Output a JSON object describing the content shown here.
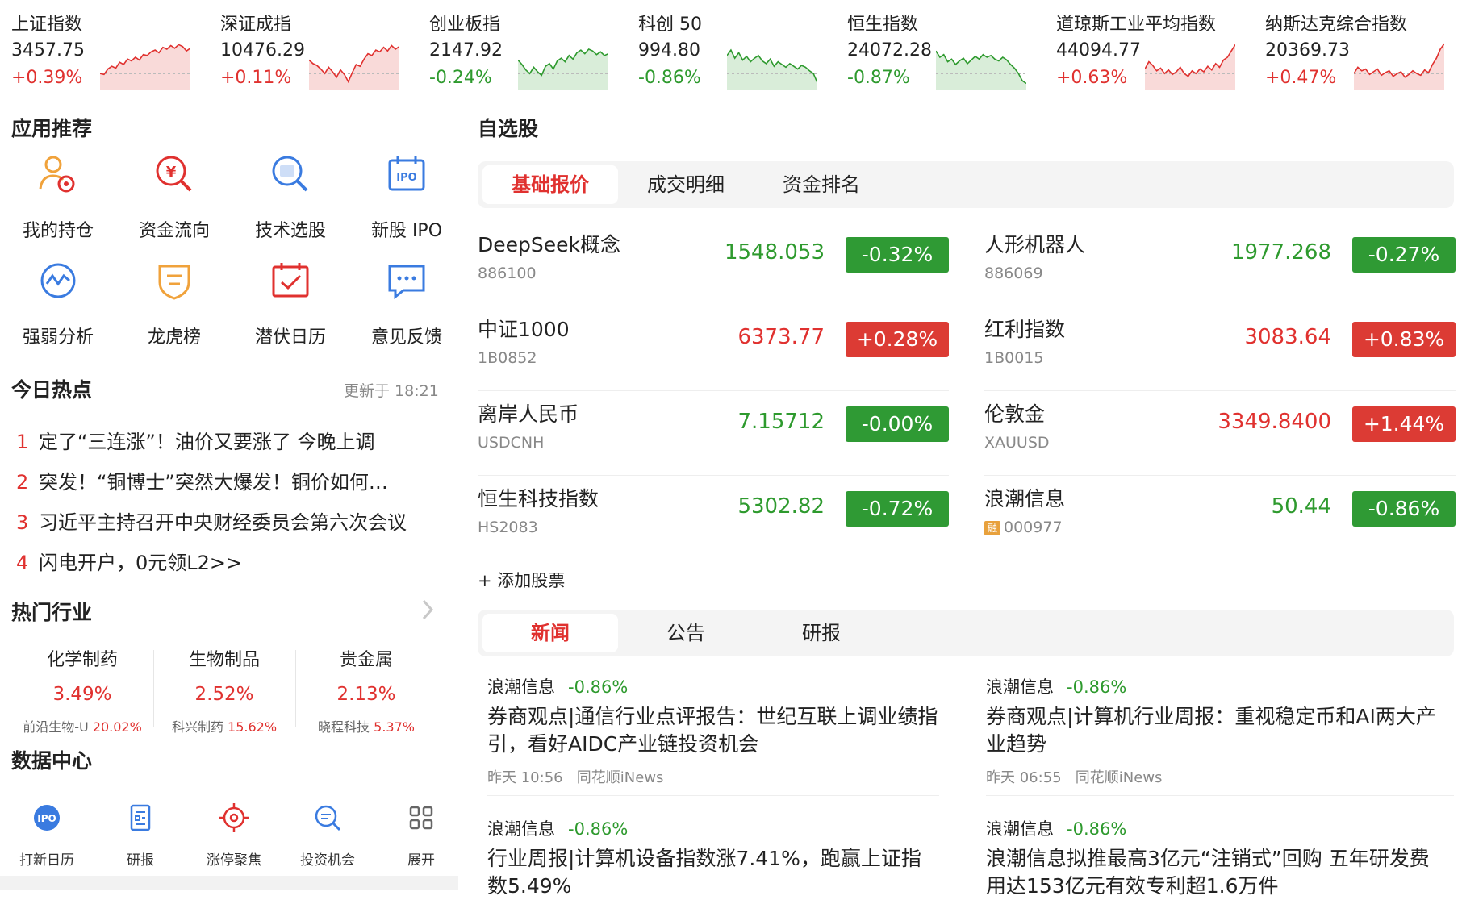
{
  "indices": [
    {
      "name": "上证指数",
      "value": "3457.75",
      "change": "+0.39%",
      "dir": "up",
      "spark": [
        0.3,
        0.28,
        0.4,
        0.46,
        0.42,
        0.55,
        0.5,
        0.62,
        0.58,
        0.66,
        0.6,
        0.72,
        0.7,
        0.78,
        0.82,
        0.76,
        0.88,
        0.84,
        0.92,
        0.86,
        0.94,
        0.9,
        0.8,
        0.86
      ]
    },
    {
      "name": "深证成指",
      "value": "10476.29",
      "change": "+0.11%",
      "dir": "up",
      "spark": [
        0.6,
        0.52,
        0.48,
        0.4,
        0.3,
        0.44,
        0.34,
        0.22,
        0.38,
        0.28,
        0.12,
        0.32,
        0.5,
        0.46,
        0.62,
        0.74,
        0.7,
        0.82,
        0.78,
        0.88,
        0.8,
        0.92,
        0.84,
        0.9
      ]
    },
    {
      "name": "创业板指",
      "value": "2147.92",
      "change": "-0.24%",
      "dir": "down",
      "spark": [
        0.6,
        0.5,
        0.38,
        0.3,
        0.44,
        0.34,
        0.26,
        0.46,
        0.52,
        0.4,
        0.58,
        0.64,
        0.56,
        0.7,
        0.62,
        0.76,
        0.82,
        0.74,
        0.84,
        0.8,
        0.72,
        0.78,
        0.7,
        0.74
      ]
    },
    {
      "name": "科创 50",
      "value": "994.80",
      "change": "-0.86%",
      "dir": "down",
      "spark": [
        0.7,
        0.82,
        0.64,
        0.76,
        0.6,
        0.68,
        0.56,
        0.64,
        0.7,
        0.58,
        0.52,
        0.62,
        0.46,
        0.56,
        0.5,
        0.44,
        0.52,
        0.46,
        0.4,
        0.48,
        0.44,
        0.36,
        0.3,
        0.1
      ]
    },
    {
      "name": "恒生指数",
      "value": "24072.28",
      "change": "-0.87%",
      "dir": "down",
      "spark": [
        0.8,
        0.66,
        0.72,
        0.56,
        0.62,
        0.5,
        0.58,
        0.64,
        0.52,
        0.6,
        0.68,
        0.62,
        0.72,
        0.66,
        0.7,
        0.62,
        0.58,
        0.66,
        0.6,
        0.5,
        0.42,
        0.3,
        0.14,
        0.08
      ]
    },
    {
      "name": "道琼斯工业平均指数",
      "value": "44094.77",
      "change": "+0.63%",
      "dir": "up",
      "spark": [
        0.4,
        0.56,
        0.48,
        0.36,
        0.42,
        0.3,
        0.38,
        0.28,
        0.34,
        0.44,
        0.3,
        0.24,
        0.36,
        0.3,
        0.4,
        0.34,
        0.46,
        0.38,
        0.52,
        0.44,
        0.6,
        0.66,
        0.8,
        0.94
      ]
    },
    {
      "name": "纳斯达克综合指数",
      "value": "20369.73",
      "change": "+0.47%",
      "dir": "up",
      "spark": [
        0.3,
        0.44,
        0.36,
        0.4,
        0.28,
        0.34,
        0.4,
        0.26,
        0.32,
        0.36,
        0.24,
        0.3,
        0.34,
        0.22,
        0.28,
        0.36,
        0.3,
        0.26,
        0.38,
        0.32,
        0.5,
        0.64,
        0.84,
        0.96
      ]
    }
  ],
  "app_section": {
    "title": "应用推荐",
    "apps": [
      {
        "label": "我的持仓",
        "icon": "portfolio-icon",
        "color": "#f0a23b"
      },
      {
        "label": "资金流向",
        "icon": "money-flow-icon",
        "color": "#e0312f"
      },
      {
        "label": "技术选股",
        "icon": "stock-picker-icon",
        "color": "#3a7be0"
      },
      {
        "label": "新股 IPO",
        "icon": "ipo-calendar-icon",
        "color": "#3a7be0"
      },
      {
        "label": "强弱分析",
        "icon": "strength-analysis-icon",
        "color": "#3a7be0"
      },
      {
        "label": "龙虎榜",
        "icon": "dragon-tiger-list-icon",
        "color": "#f0a23b"
      },
      {
        "label": "潜伏日历",
        "icon": "calendar-icon",
        "color": "#e0312f"
      },
      {
        "label": "意见反馈",
        "icon": "feedback-icon",
        "color": "#3a7be0"
      }
    ]
  },
  "hot": {
    "title": "今日热点",
    "updated": "更新于 18:21",
    "items": [
      {
        "no": "1",
        "text": "定了“三连涨”！油价又要涨了 今晚上调"
      },
      {
        "no": "2",
        "text": "突发！“铜博士”突然大爆发！铜价如何…"
      },
      {
        "no": "3",
        "text": "习近平主持召开中央财经委员会第六次会议"
      },
      {
        "no": "4",
        "text": "闪电开户，0元领L2>>"
      }
    ]
  },
  "industry": {
    "title": "热门行业",
    "items": [
      {
        "name": "化学制药",
        "pct": "3.49%",
        "stock": "前沿生物-U",
        "stock_pct": "20.02%"
      },
      {
        "name": "生物制品",
        "pct": "2.52%",
        "stock": "科兴制药",
        "stock_pct": "15.62%"
      },
      {
        "name": "贵金属",
        "pct": "2.13%",
        "stock": "晓程科技",
        "stock_pct": "5.37%"
      }
    ]
  },
  "data_center": {
    "title": "数据中心",
    "items": [
      {
        "label": "打新日历",
        "icon": "ipo-badge-icon"
      },
      {
        "label": "研报",
        "icon": "report-icon"
      },
      {
        "label": "涨停聚焦",
        "icon": "target-icon"
      },
      {
        "label": "投资机会",
        "icon": "search-opportunity-icon"
      },
      {
        "label": "展开",
        "icon": "grid-more-icon"
      }
    ]
  },
  "watchlist": {
    "title": "自选股",
    "tabs": [
      "基础报价",
      "成交明细",
      "资金排名"
    ],
    "add_label": "+ 添加股票",
    "stocks": [
      {
        "name": "DeepSeek概念",
        "code": "886100",
        "price": "1548.053",
        "change": "-0.32%",
        "dir": "down",
        "margin": ""
      },
      {
        "name": "人形机器人",
        "code": "886069",
        "price": "1977.268",
        "change": "-0.27%",
        "dir": "down",
        "margin": ""
      },
      {
        "name": "中证1000",
        "code": "1B0852",
        "price": "6373.77",
        "change": "+0.28%",
        "dir": "up",
        "margin": ""
      },
      {
        "name": "红利指数",
        "code": "1B0015",
        "price": "3083.64",
        "change": "+0.83%",
        "dir": "up",
        "margin": ""
      },
      {
        "name": "离岸人民币",
        "code": "USDCNH",
        "price": "7.15712",
        "change": "-0.00%",
        "dir": "down",
        "margin": ""
      },
      {
        "name": "伦敦金",
        "code": "XAUUSD",
        "price": "3349.8400",
        "change": "+1.44%",
        "dir": "up",
        "margin": ""
      },
      {
        "name": "恒生科技指数",
        "code": "HS2083",
        "price": "5302.82",
        "change": "-0.72%",
        "dir": "down",
        "margin": ""
      },
      {
        "name": "浪潮信息",
        "code": "000977",
        "price": "50.44",
        "change": "-0.86%",
        "dir": "down",
        "margin": "融"
      }
    ]
  },
  "news": {
    "tabs": [
      "新闻",
      "公告",
      "研报"
    ],
    "items": [
      {
        "stock": "浪潮信息",
        "change": "-0.86%",
        "title": "券商观点|通信行业点评报告：世纪互联上调业绩指引，看好AIDC产业链投资机会",
        "time": "昨天 10:56",
        "source": "同花顺iNews"
      },
      {
        "stock": "浪潮信息",
        "change": "-0.86%",
        "title": "券商观点|计算机行业周报：重视稳定币和AI两大产业趋势",
        "time": "昨天 06:55",
        "source": "同花顺iNews"
      },
      {
        "stock": "浪潮信息",
        "change": "-0.86%",
        "title": "行业周报|计算机设备指数涨7.41%，跑赢上证指数5.49%",
        "time": "",
        "source": ""
      },
      {
        "stock": "浪潮信息",
        "change": "-0.86%",
        "title": "浪潮信息拟推最高3亿元“注销式”回购 五年研发费用达153亿元有效专利超1.6万件",
        "time": "",
        "source": ""
      }
    ]
  }
}
